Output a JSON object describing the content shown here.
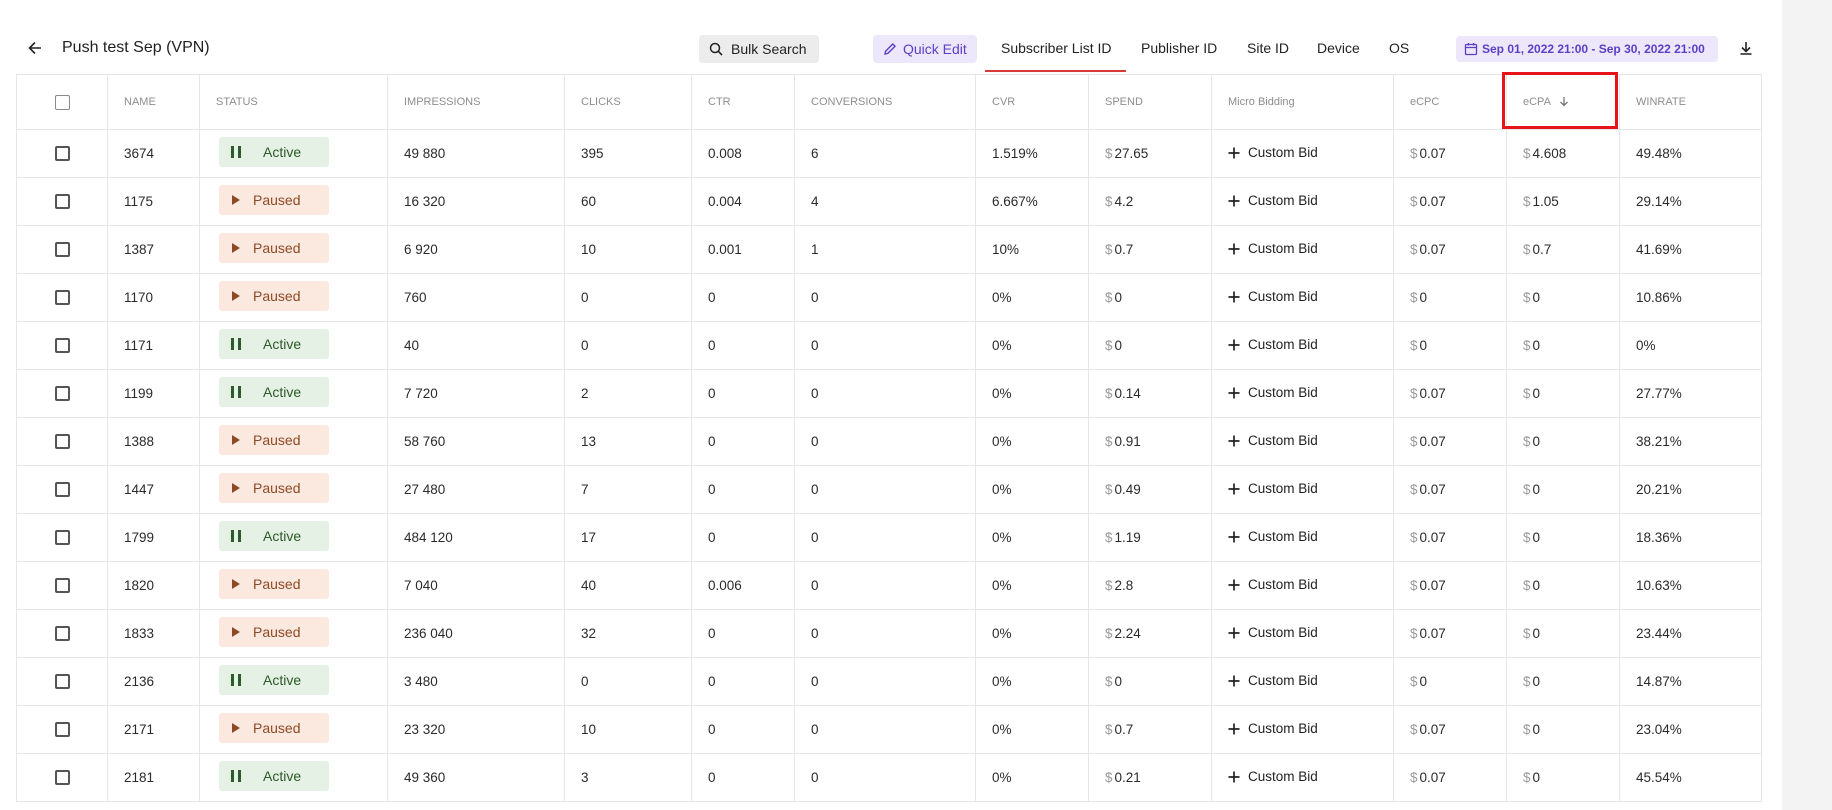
{
  "header": {
    "title": "Push test Sep (VPN)",
    "bulk_search_label": "Bulk Search",
    "quick_edit_label": "Quick Edit",
    "tabs": [
      {
        "label": "Subscriber List ID",
        "active": true
      },
      {
        "label": "Publisher ID",
        "active": false
      },
      {
        "label": "Site ID",
        "active": false
      },
      {
        "label": "Device",
        "active": false
      },
      {
        "label": "OS",
        "active": false
      }
    ],
    "date_range": "Sep 01, 2022 21:00 - Sep 30, 2022 21:00",
    "accent_color": "#5b3fc4",
    "active_tab_color": "#d83a3a"
  },
  "table": {
    "columns": [
      "NAME",
      "STATUS",
      "IMPRESSIONS",
      "CLICKS",
      "CTR",
      "CONVERSIONS",
      "CVR",
      "SPEND",
      "Micro Bidding",
      "eCPC",
      "eCPA",
      "WINRATE"
    ],
    "sorted_column": "eCPA",
    "sort_direction": "desc",
    "bid_label": "Custom Bid",
    "currency_symbol": "$",
    "rows": [
      {
        "name": "3674",
        "status": "Active",
        "impressions": "49 880",
        "clicks": "395",
        "ctr": "0.008",
        "conversions": "6",
        "cvr": "1.519%",
        "spend": "27.65",
        "ecpc": "0.07",
        "ecpa": "4.608",
        "winrate": "49.48%"
      },
      {
        "name": "1175",
        "status": "Paused",
        "impressions": "16 320",
        "clicks": "60",
        "ctr": "0.004",
        "conversions": "4",
        "cvr": "6.667%",
        "spend": "4.2",
        "ecpc": "0.07",
        "ecpa": "1.05",
        "winrate": "29.14%"
      },
      {
        "name": "1387",
        "status": "Paused",
        "impressions": "6 920",
        "clicks": "10",
        "ctr": "0.001",
        "conversions": "1",
        "cvr": "10%",
        "spend": "0.7",
        "ecpc": "0.07",
        "ecpa": "0.7",
        "winrate": "41.69%"
      },
      {
        "name": "1170",
        "status": "Paused",
        "impressions": "760",
        "clicks": "0",
        "ctr": "0",
        "conversions": "0",
        "cvr": "0%",
        "spend": "0",
        "ecpc": "0",
        "ecpa": "0",
        "winrate": "10.86%"
      },
      {
        "name": "1171",
        "status": "Active",
        "impressions": "40",
        "clicks": "0",
        "ctr": "0",
        "conversions": "0",
        "cvr": "0%",
        "spend": "0",
        "ecpc": "0",
        "ecpa": "0",
        "winrate": "0%"
      },
      {
        "name": "1199",
        "status": "Active",
        "impressions": "7 720",
        "clicks": "2",
        "ctr": "0",
        "conversions": "0",
        "cvr": "0%",
        "spend": "0.14",
        "ecpc": "0.07",
        "ecpa": "0",
        "winrate": "27.77%"
      },
      {
        "name": "1388",
        "status": "Paused",
        "impressions": "58 760",
        "clicks": "13",
        "ctr": "0",
        "conversions": "0",
        "cvr": "0%",
        "spend": "0.91",
        "ecpc": "0.07",
        "ecpa": "0",
        "winrate": "38.21%"
      },
      {
        "name": "1447",
        "status": "Paused",
        "impressions": "27 480",
        "clicks": "7",
        "ctr": "0",
        "conversions": "0",
        "cvr": "0%",
        "spend": "0.49",
        "ecpc": "0.07",
        "ecpa": "0",
        "winrate": "20.21%"
      },
      {
        "name": "1799",
        "status": "Active",
        "impressions": "484 120",
        "clicks": "17",
        "ctr": "0",
        "conversions": "0",
        "cvr": "0%",
        "spend": "1.19",
        "ecpc": "0.07",
        "ecpa": "0",
        "winrate": "18.36%"
      },
      {
        "name": "1820",
        "status": "Paused",
        "impressions": "7 040",
        "clicks": "40",
        "ctr": "0.006",
        "conversions": "0",
        "cvr": "0%",
        "spend": "2.8",
        "ecpc": "0.07",
        "ecpa": "0",
        "winrate": "10.63%"
      },
      {
        "name": "1833",
        "status": "Paused",
        "impressions": "236 040",
        "clicks": "32",
        "ctr": "0",
        "conversions": "0",
        "cvr": "0%",
        "spend": "2.24",
        "ecpc": "0.07",
        "ecpa": "0",
        "winrate": "23.44%"
      },
      {
        "name": "2136",
        "status": "Active",
        "impressions": "3 480",
        "clicks": "0",
        "ctr": "0",
        "conversions": "0",
        "cvr": "0%",
        "spend": "0",
        "ecpc": "0",
        "ecpa": "0",
        "winrate": "14.87%"
      },
      {
        "name": "2171",
        "status": "Paused",
        "impressions": "23 320",
        "clicks": "10",
        "ctr": "0",
        "conversions": "0",
        "cvr": "0%",
        "spend": "0.7",
        "ecpc": "0.07",
        "ecpa": "0",
        "winrate": "23.04%"
      },
      {
        "name": "2181",
        "status": "Active",
        "impressions": "49 360",
        "clicks": "3",
        "ctr": "0",
        "conversions": "0",
        "cvr": "0%",
        "spend": "0.21",
        "ecpc": "0.07",
        "ecpa": "0",
        "winrate": "45.54%"
      }
    ]
  }
}
